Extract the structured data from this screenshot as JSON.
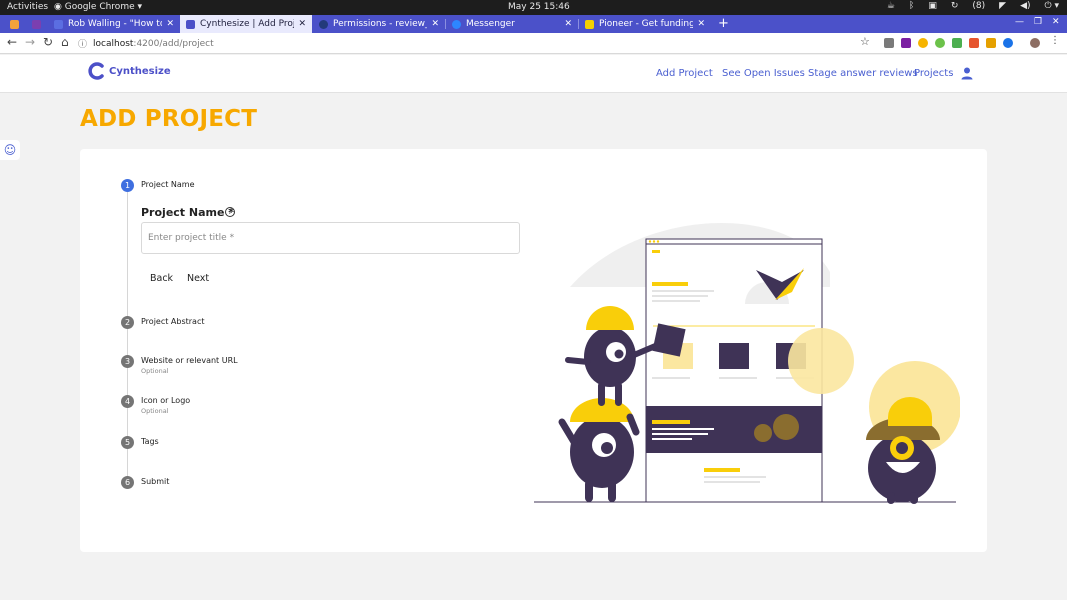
{
  "system_bar": {
    "activities": "Activities",
    "app_name": "Google Chrome",
    "clock": "May 25  15:46",
    "notification_count": "(8)"
  },
  "browser": {
    "tabs": [
      {
        "label": "Rob Walling - \"How to Va",
        "favicon_color": "#5b6ee1"
      },
      {
        "label": "Cynthesize | Add Project",
        "favicon_color": "#4c50c8",
        "active": true
      },
      {
        "label": "Permissions - review_com",
        "favicon_color": "#233a7a"
      },
      {
        "label": "Messenger",
        "favicon_color": "#2d86ff"
      },
      {
        "label": "Pioneer - Get funding and",
        "favicon_color": "#f4d000"
      }
    ],
    "url": {
      "host": "localhost",
      "path": ":4200/add/project"
    }
  },
  "header": {
    "logo_text": "Cynthesize",
    "nav": [
      "Add Project",
      "See Open Issues",
      "Stage answer reviews",
      "Projects"
    ]
  },
  "page": {
    "title": "ADD PROJECT"
  },
  "stepper": {
    "steps": [
      {
        "number": "1",
        "label": "Project Name",
        "optional": ""
      },
      {
        "number": "2",
        "label": "Project Abstract",
        "optional": ""
      },
      {
        "number": "3",
        "label": "Website or relevant URL",
        "optional": "Optional"
      },
      {
        "number": "4",
        "label": "Icon or Logo",
        "optional": "Optional"
      },
      {
        "number": "5",
        "label": "Tags",
        "optional": ""
      },
      {
        "number": "6",
        "label": "Submit",
        "optional": ""
      }
    ],
    "field_title": "Project Name *",
    "input_placeholder": "Enter project title *",
    "input_value": "",
    "back_label": "Back",
    "next_label": "Next"
  },
  "colors": {
    "accent": "#f7a800",
    "brand": "#4c50c8",
    "link": "#4a5fd0",
    "illustration_yellow": "#f9ce0a",
    "illustration_purple": "#3f3356"
  }
}
